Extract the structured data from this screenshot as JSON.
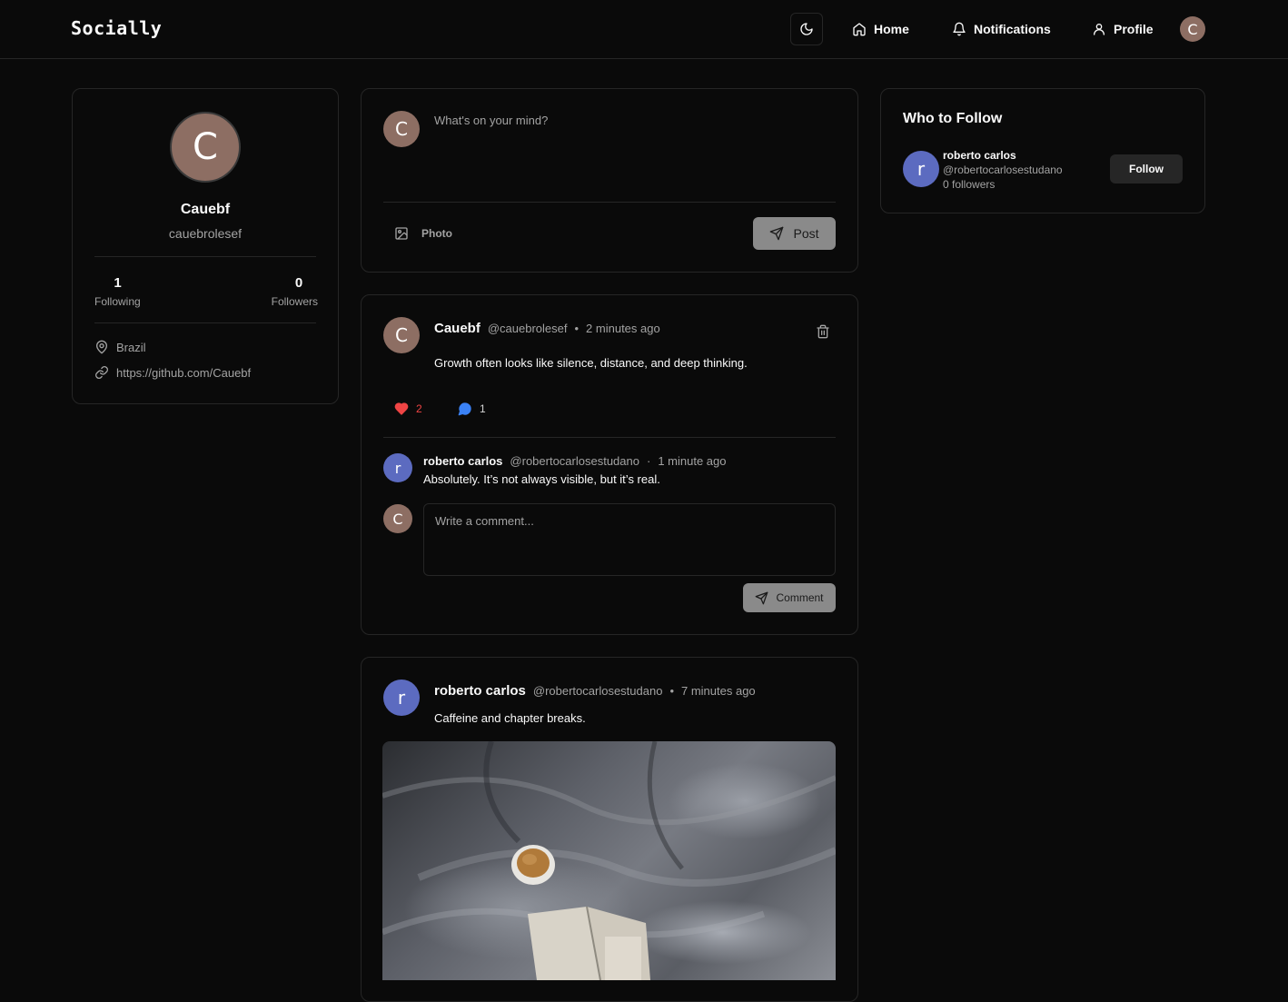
{
  "app": {
    "logo": "Socially"
  },
  "nav": {
    "home": "Home",
    "notifications": "Notifications",
    "profile": "Profile",
    "avatar_initial": "C"
  },
  "profile_card": {
    "avatar_initial": "C",
    "name": "Cauebf",
    "username": "cauebrolesef",
    "following_count": "1",
    "following_label": "Following",
    "followers_count": "0",
    "followers_label": "Followers",
    "location": "Brazil",
    "website": "https://github.com/Cauebf"
  },
  "composer": {
    "avatar_initial": "C",
    "placeholder": "What's on your mind?",
    "photo_label": "Photo",
    "post_label": "Post"
  },
  "posts": [
    {
      "avatar_initial": "C",
      "author": "Cauebf",
      "handle": "@cauebrolesef",
      "time": "2 minutes ago",
      "content": "Growth often looks like silence, distance, and deep thinking.",
      "likes": "2",
      "comments": "1",
      "comment_list": [
        {
          "avatar_initial": "r",
          "author": "roberto carlos",
          "handle": "@robertocarlosestudano",
          "time": "1 minute ago",
          "content": "Absolutely. It’s not always visible, but it’s real."
        }
      ],
      "comment_avatar_initial": "C",
      "comment_placeholder": "Write a comment...",
      "comment_button": "Comment"
    },
    {
      "avatar_initial": "r",
      "author": "roberto carlos",
      "handle": "@robertocarlosestudano",
      "time": "7 minutes ago",
      "content": "Caffeine and chapter breaks."
    }
  ],
  "who_to_follow": {
    "title": "Who to Follow",
    "users": [
      {
        "avatar_initial": "r",
        "name": "roberto carlos",
        "handle": "@robertocarlosestudano",
        "followers": "0 followers",
        "button": "Follow"
      }
    ]
  },
  "colors": {
    "background": "#0a0a0a",
    "border": "#262626",
    "like_red": "#ef4444",
    "comment_blue": "#3b82f6",
    "avatar_c": "#8d6e63",
    "avatar_r": "#5c6bc0"
  }
}
